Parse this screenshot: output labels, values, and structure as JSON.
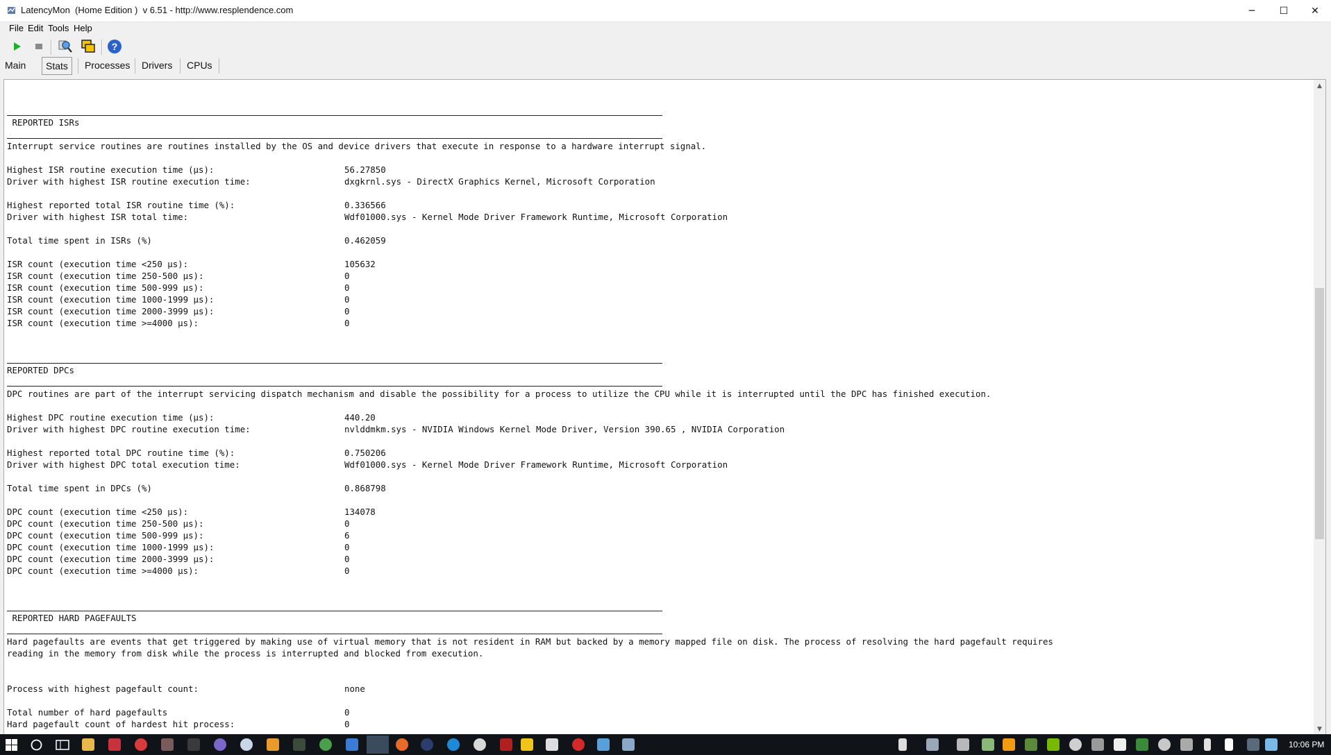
{
  "window": {
    "title": "LatencyMon  (Home Edition )  v 6.51 - http://www.resplendence.com",
    "minimize_glyph": "─",
    "maximize_glyph": "☐",
    "close_glyph": "✕"
  },
  "menu": [
    "File",
    "Edit",
    "Tools",
    "Help"
  ],
  "toolbar": {
    "icons": [
      "play-icon",
      "stop-icon",
      "search-drivers-icon",
      "window-copy-icon",
      "help-icon"
    ]
  },
  "tabs": [
    "Main",
    "Stats",
    "Processes",
    "Drivers",
    "CPUs"
  ],
  "active_tab": "Stats",
  "report": {
    "isr": {
      "header": " REPORTED ISRs",
      "description": "Interrupt service routines are routines installed by the OS and device drivers that execute in response to a hardware interrupt signal.",
      "rows": [
        {
          "label": "Highest ISR routine execution time (µs):",
          "value": "56.27850"
        },
        {
          "label": "Driver with highest ISR routine execution time:",
          "value": "dxgkrnl.sys - DirectX Graphics Kernel, Microsoft Corporation"
        },
        {
          "label": "Highest reported total ISR routine time (%):",
          "value": "0.336566"
        },
        {
          "label": "Driver with highest ISR total time:",
          "value": "Wdf01000.sys - Kernel Mode Driver Framework Runtime, Microsoft Corporation"
        },
        {
          "label": "Total time spent in ISRs (%)",
          "value": "0.462059"
        },
        {
          "label": "ISR count (execution time <250 µs):",
          "value": "105632"
        },
        {
          "label": "ISR count (execution time 250-500 µs):",
          "value": "0"
        },
        {
          "label": "ISR count (execution time 500-999 µs):",
          "value": "0"
        },
        {
          "label": "ISR count (execution time 1000-1999 µs):",
          "value": "0"
        },
        {
          "label": "ISR count (execution time 2000-3999 µs):",
          "value": "0"
        },
        {
          "label": "ISR count (execution time >=4000 µs):",
          "value": "0"
        }
      ]
    },
    "dpc": {
      "header": "REPORTED DPCs",
      "description": "DPC routines are part of the interrupt servicing dispatch mechanism and disable the possibility for a process to utilize the CPU while it is interrupted until the DPC has finished execution.",
      "rows": [
        {
          "label": "Highest DPC routine execution time (µs):",
          "value": "440.20"
        },
        {
          "label": "Driver with highest DPC routine execution time:",
          "value": "nvlddmkm.sys - NVIDIA Windows Kernel Mode Driver, Version 390.65 , NVIDIA Corporation"
        },
        {
          "label": "Highest reported total DPC routine time (%):",
          "value": "0.750206"
        },
        {
          "label": "Driver with highest DPC total execution time:",
          "value": "Wdf01000.sys - Kernel Mode Driver Framework Runtime, Microsoft Corporation"
        },
        {
          "label": "Total time spent in DPCs (%)",
          "value": "0.868798"
        },
        {
          "label": "DPC count (execution time <250 µs):",
          "value": "134078"
        },
        {
          "label": "DPC count (execution time 250-500 µs):",
          "value": "0"
        },
        {
          "label": "DPC count (execution time 500-999 µs):",
          "value": "6"
        },
        {
          "label": "DPC count (execution time 1000-1999 µs):",
          "value": "0"
        },
        {
          "label": "DPC count (execution time 2000-3999 µs):",
          "value": "0"
        },
        {
          "label": "DPC count (execution time >=4000 µs):",
          "value": "0"
        }
      ]
    },
    "pagefaults": {
      "header": " REPORTED HARD PAGEFAULTS",
      "description_1": "Hard pagefaults are events that get triggered by making use of virtual memory that is not resident in RAM but backed by a memory mapped file on disk. The process of resolving the hard pagefault requires",
      "description_2": "reading in the memory from disk while the process is interrupted and blocked from execution.",
      "rows": [
        {
          "label": "Process with highest pagefault count:",
          "value": "none"
        },
        {
          "label": "Total number of hard pagefaults",
          "value": "0"
        },
        {
          "label": "Hard pagefault count of hardest hit process:",
          "value": "0"
        }
      ]
    }
  },
  "taskbar": {
    "time": "10:06 PM"
  }
}
